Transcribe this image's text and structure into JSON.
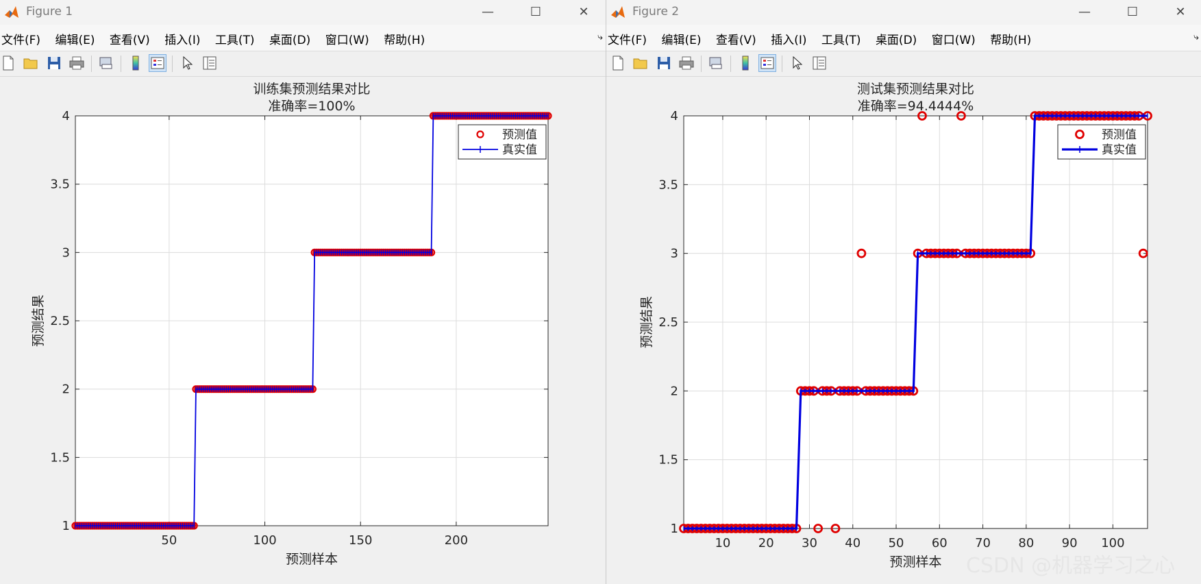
{
  "windows": [
    {
      "title": "Figure 1",
      "menu": [
        "文件(F)",
        "编辑(E)",
        "查看(V)",
        "插入(I)",
        "工具(T)",
        "桌面(D)",
        "窗口(W)",
        "帮助(H)"
      ]
    },
    {
      "title": "Figure 2",
      "menu": [
        "文件(F)",
        "编辑(E)",
        "查看(V)",
        "插入(I)",
        "工具(T)",
        "桌面(D)",
        "窗口(W)",
        "帮助(H)"
      ]
    }
  ],
  "watermark": "CSDN @机器学习之心",
  "colors": {
    "marker": "#e00000",
    "line": "#0000e0",
    "grid": "#dcdcdc",
    "titlebar_text": "#7a7a7a"
  },
  "icons": [
    "new-file-icon",
    "open-folder-icon",
    "save-icon",
    "print-icon",
    "print-preview-icon",
    "colorbar-icon",
    "legend-icon",
    "pointer-icon",
    "property-inspector-icon"
  ],
  "chart_data": [
    {
      "type": "line",
      "title": "训练集预测结果对比",
      "subtitle": "准确率=100%",
      "xlabel": "预测样本",
      "ylabel": "预测结果",
      "xlim": [
        1,
        248
      ],
      "ylim": [
        1,
        4
      ],
      "xticks": [
        50,
        100,
        150,
        200
      ],
      "yticks": [
        1,
        1.5,
        2,
        2.5,
        3,
        3.5,
        4
      ],
      "grid": true,
      "legend_position": "top-right",
      "series": [
        {
          "name": "预测值",
          "segments": [
            [
              1,
              63,
              1
            ],
            [
              64,
              125,
              2
            ],
            [
              126,
              187,
              3
            ],
            [
              188,
              248,
              4
            ]
          ],
          "outliers": []
        },
        {
          "name": "真实值",
          "segments": [
            [
              1,
              63,
              1
            ],
            [
              64,
              125,
              2
            ],
            [
              126,
              187,
              3
            ],
            [
              188,
              248,
              4
            ]
          ]
        }
      ]
    },
    {
      "type": "line",
      "title": "测试集预测结果对比",
      "subtitle": "准确率=94.4444%",
      "xlabel": "预测样本",
      "ylabel": "预测结果",
      "xlim": [
        1,
        108
      ],
      "ylim": [
        1,
        4
      ],
      "xticks": [
        10,
        20,
        30,
        40,
        50,
        60,
        70,
        80,
        90,
        100
      ],
      "yticks": [
        1,
        1.5,
        2,
        2.5,
        3,
        3.5,
        4
      ],
      "grid": true,
      "legend_position": "top-right",
      "series": [
        {
          "name": "预测值",
          "segments": [
            [
              1,
              27,
              1
            ],
            [
              28,
              54,
              2
            ],
            [
              55,
              81,
              3
            ],
            [
              82,
              108,
              4
            ]
          ],
          "outliers": [
            [
              32,
              1
            ],
            [
              36,
              1
            ],
            [
              42,
              3
            ],
            [
              56,
              4
            ],
            [
              65,
              4
            ],
            [
              107,
              3
            ]
          ]
        },
        {
          "name": "真实值",
          "segments": [
            [
              1,
              27,
              1
            ],
            [
              28,
              54,
              2
            ],
            [
              55,
              81,
              3
            ],
            [
              82,
              108,
              4
            ]
          ]
        }
      ]
    }
  ]
}
